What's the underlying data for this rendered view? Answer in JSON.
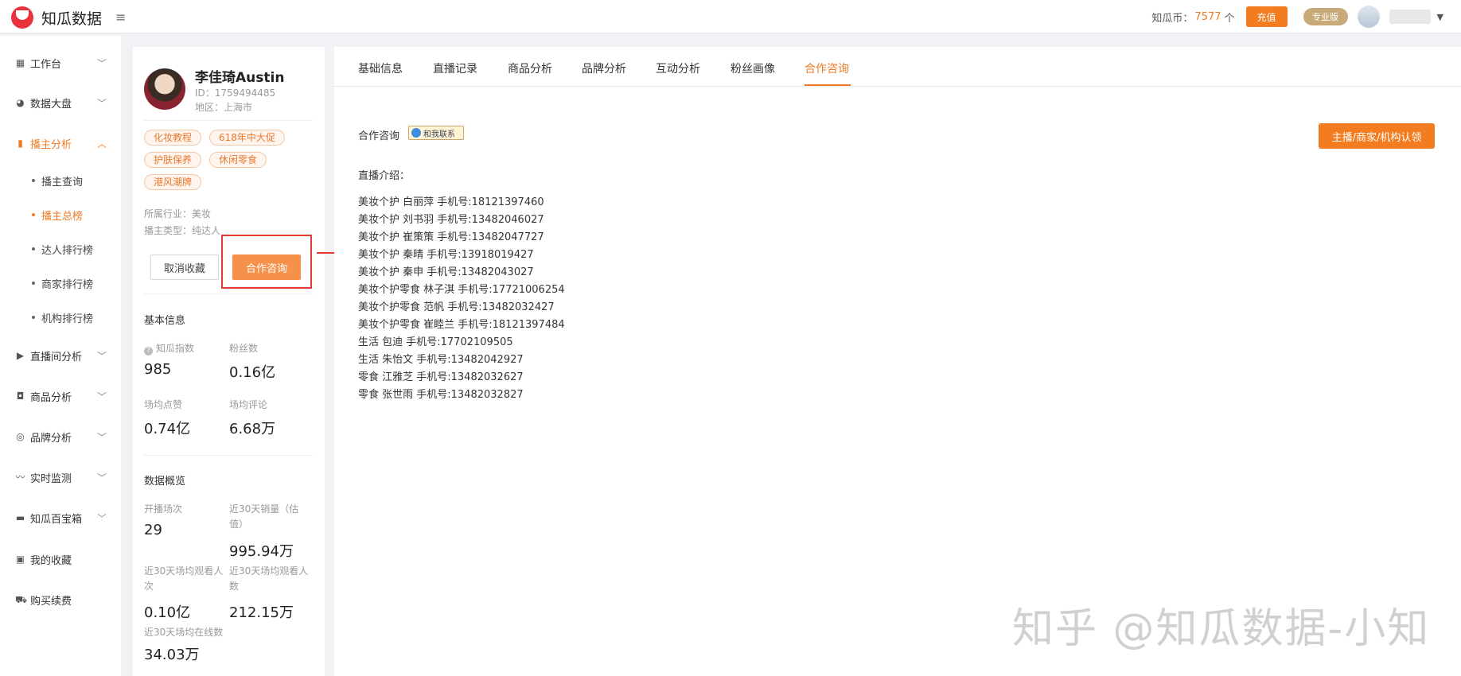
{
  "app": {
    "name": "知瓜数据"
  },
  "topbar": {
    "coin_label": "知瓜币：",
    "coin_value": "7577",
    "coin_unit": "个",
    "recharge_label": "充值",
    "pro_badge": "专业版"
  },
  "sidebar": {
    "items": [
      {
        "label": "工作台",
        "icon": "dashboard-icon"
      },
      {
        "label": "数据大盘",
        "icon": "pie-chart-icon"
      },
      {
        "label": "播主分析",
        "icon": "bar-chart-icon"
      },
      {
        "label": "直播间分析",
        "icon": "live-icon"
      },
      {
        "label": "商品分析",
        "icon": "bag-icon"
      },
      {
        "label": "品牌分析",
        "icon": "brand-icon"
      },
      {
        "label": "实时监测",
        "icon": "trend-icon"
      },
      {
        "label": "知瓜百宝箱",
        "icon": "toolbox-icon"
      },
      {
        "label": "我的收藏",
        "icon": "bookmark-icon"
      },
      {
        "label": "购买续费",
        "icon": "cart-icon"
      }
    ],
    "sub_items": [
      "播主查询",
      "播主总榜",
      "达人排行榜",
      "商家排行榜",
      "机构排行榜"
    ]
  },
  "profile": {
    "name": "李佳琦Austin",
    "id": "ID：1759494485",
    "region": "地区：上海市",
    "tags": [
      "化妆教程",
      "618年中大促",
      "护肤保养",
      "休闲零食",
      "港风潮牌"
    ],
    "industry": "所属行业：美妆",
    "type": "播主类型：纯达人",
    "unfav_label": "取消收藏",
    "consult_label": "合作咨询",
    "basic_title": "基本信息",
    "basic_stats": [
      {
        "label": "知瓜指数",
        "value": "985"
      },
      {
        "label": "粉丝数",
        "value": "0.16亿"
      },
      {
        "label": "场均点赞",
        "value": "0.74亿"
      },
      {
        "label": "场均评论",
        "value": "6.68万"
      }
    ],
    "overview_title": "数据概览",
    "overview_stats": [
      {
        "label": "开播场次",
        "value": "29"
      },
      {
        "label": "近30天销量（估值）",
        "value": "995.94万"
      },
      {
        "label": "近30天场均观看人次",
        "value": "0.10亿"
      },
      {
        "label": "近30天场均观看人数",
        "value": "212.15万"
      },
      {
        "label": "近30天场均在线数",
        "value": "34.03万"
      }
    ]
  },
  "main": {
    "tabs": [
      "基础信息",
      "直播记录",
      "商品分析",
      "品牌分析",
      "互动分析",
      "粉丝画像",
      "合作咨询"
    ],
    "active_tab": "合作咨询",
    "consult_label": "合作咨询",
    "contact_badge": "和我联系",
    "claim_button": "主播/商家/机构认领",
    "intro_title": "直播介绍：",
    "contacts": [
      "美妆个护 白丽萍 手机号:18121397460",
      "美妆个护 刘书羽 手机号:13482046027",
      "美妆个护 崔策策 手机号:13482047727",
      "美妆个护 秦晴 手机号:13918019427",
      "美妆个护 秦申 手机号:13482043027",
      "美妆个护零食 林子淇 手机号:17721006254",
      "美妆个护零食 范帆 手机号:13482032427",
      "美妆个护零食 崔睦兰 手机号:18121397484",
      "生活 包迪 手机号:17702109505",
      "生活 朱怡文 手机号:13482042927",
      "零食 江雅芝 手机号:13482032627",
      "零食 张世雨 手机号:13482032827"
    ]
  },
  "watermark": "知乎 @知瓜数据-小知",
  "colors": {
    "accent": "#f07b26",
    "highlight": "#e53935"
  }
}
